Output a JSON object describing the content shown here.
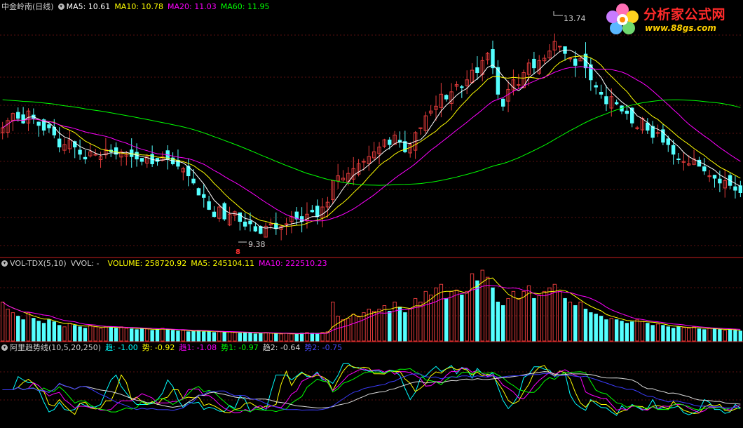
{
  "colors": {
    "background": "#000000",
    "up": "#e33b3b",
    "down": "#54ffff",
    "ma5": "#ffffff",
    "ma10": "#ffff00",
    "ma20": "#ff00ff",
    "ma60": "#00ff00",
    "label_white": "#cfcfcf",
    "divider": "#c81e1e"
  },
  "main_panel": {
    "title": "中金岭南(日线)",
    "menu_icon": "circle-caret-icon",
    "ma5": "MA5: 10.61",
    "ma10": "MA10: 10.78",
    "ma20": "MA20: 11.03",
    "ma60": "MA60: 11.95",
    "high_label": "13.74",
    "low_label": "9.38",
    "low_marker": "8"
  },
  "volume_panel": {
    "title": "VOL-TDX(5,10)",
    "vvol": "VVOL: -",
    "volume": "VOLUME: 258720.92",
    "ma5": "MA5: 245104.11",
    "ma10": "MA10: 222510.23"
  },
  "indicator_panel": {
    "title": "阿里趋势线(10,5,20,250)",
    "qu": "趋: -1.00",
    "shi": "势: -0.92",
    "qu1": "趋1: -1.08",
    "shi1": "势1: -0.97",
    "qu2": "趋2: -0.64",
    "shi2": "势2: -0.75",
    "colors": {
      "qu": "#00ffff",
      "shi": "#ffff00",
      "qu1": "#ff00ff",
      "shi1": "#00ff00",
      "qu2": "#dddddd",
      "shi2": "#3c3cff"
    }
  },
  "logo": {
    "text": "分析家公式网",
    "url": "www.88gs.com",
    "icon": "flower-logo-icon"
  },
  "chart_data": {
    "type": "candlestick",
    "ylim": [
      9.0,
      14.0
    ],
    "grid": true,
    "high": 13.74,
    "low": 9.38,
    "closes": [
      11.6,
      11.75,
      11.9,
      11.8,
      11.7,
      11.95,
      11.8,
      11.65,
      11.55,
      11.6,
      11.45,
      11.2,
      11.25,
      11.35,
      11.2,
      11.05,
      10.95,
      11.1,
      11.05,
      11.0,
      11.15,
      11.1,
      11.05,
      11.1,
      11.05,
      11.0,
      10.95,
      10.9,
      11.0,
      10.85,
      10.9,
      11.0,
      10.95,
      10.85,
      10.8,
      10.75,
      10.6,
      10.45,
      10.2,
      10.15,
      9.9,
      9.75,
      9.95,
      9.7,
      9.8,
      9.85,
      9.65,
      9.55,
      9.6,
      9.45,
      9.4,
      9.55,
      9.6,
      9.5,
      9.55,
      9.6,
      9.75,
      9.7,
      9.65,
      9.8,
      9.85,
      9.75,
      9.95,
      10.05,
      10.5,
      10.6,
      10.55,
      10.65,
      10.75,
      10.85,
      10.9,
      11.0,
      11.1,
      11.2,
      11.35,
      11.25,
      11.45,
      11.3,
      11.1,
      11.25,
      11.5,
      11.6,
      11.85,
      11.95,
      12.05,
      12.3,
      12.2,
      12.35,
      12.5,
      12.45,
      12.6,
      12.8,
      12.75,
      13.0,
      13.15,
      12.85,
      12.3,
      12.05,
      12.4,
      12.6,
      12.5,
      12.75,
      12.95,
      12.85,
      13.0,
      13.05,
      13.2,
      13.4,
      13.3,
      13.15,
      13.05,
      12.9,
      13.05,
      12.85,
      12.6,
      12.45,
      12.3,
      12.1,
      12.25,
      12.1,
      11.95,
      11.9,
      11.7,
      11.6,
      11.8,
      11.55,
      11.4,
      11.5,
      11.3,
      11.25,
      11.05,
      10.95,
      10.9,
      10.85,
      10.95,
      10.8,
      10.7,
      10.6,
      10.55,
      10.45,
      10.5,
      10.4,
      10.3,
      10.25
    ],
    "volumes": [
      0.55,
      0.45,
      0.4,
      0.35,
      0.3,
      0.4,
      0.32,
      0.28,
      0.25,
      0.3,
      0.27,
      0.22,
      0.2,
      0.25,
      0.22,
      0.2,
      0.18,
      0.22,
      0.2,
      0.18,
      0.2,
      0.19,
      0.18,
      0.2,
      0.18,
      0.17,
      0.16,
      0.18,
      0.17,
      0.15,
      0.16,
      0.18,
      0.16,
      0.15,
      0.14,
      0.15,
      0.13,
      0.14,
      0.15,
      0.13,
      0.14,
      0.12,
      0.13,
      0.12,
      0.13,
      0.12,
      0.11,
      0.12,
      0.12,
      0.1,
      0.11,
      0.12,
      0.11,
      0.1,
      0.1,
      0.11,
      0.1,
      0.1,
      0.11,
      0.12,
      0.11,
      0.1,
      0.12,
      0.13,
      0.55,
      0.35,
      0.3,
      0.32,
      0.38,
      0.35,
      0.4,
      0.45,
      0.42,
      0.45,
      0.5,
      0.42,
      0.55,
      0.48,
      0.4,
      0.45,
      0.6,
      0.55,
      0.7,
      0.65,
      0.75,
      0.8,
      0.6,
      0.7,
      0.72,
      0.65,
      0.7,
      0.95,
      0.85,
      1.0,
      0.9,
      0.75,
      0.55,
      0.5,
      0.6,
      0.7,
      0.6,
      0.7,
      0.78,
      0.6,
      0.65,
      0.7,
      0.75,
      0.8,
      0.7,
      0.6,
      0.55,
      0.5,
      0.55,
      0.45,
      0.4,
      0.38,
      0.35,
      0.3,
      0.32,
      0.3,
      0.28,
      0.25,
      0.27,
      0.3,
      0.28,
      0.25,
      0.22,
      0.24,
      0.22,
      0.2,
      0.18,
      0.2,
      0.19,
      0.18,
      0.2,
      0.17,
      0.16,
      0.18,
      0.17,
      0.16,
      0.15,
      0.16,
      0.15,
      0.14
    ],
    "x_range": [
      0,
      1060
    ],
    "indicator_range": [
      -1.2,
      1.2
    ]
  }
}
